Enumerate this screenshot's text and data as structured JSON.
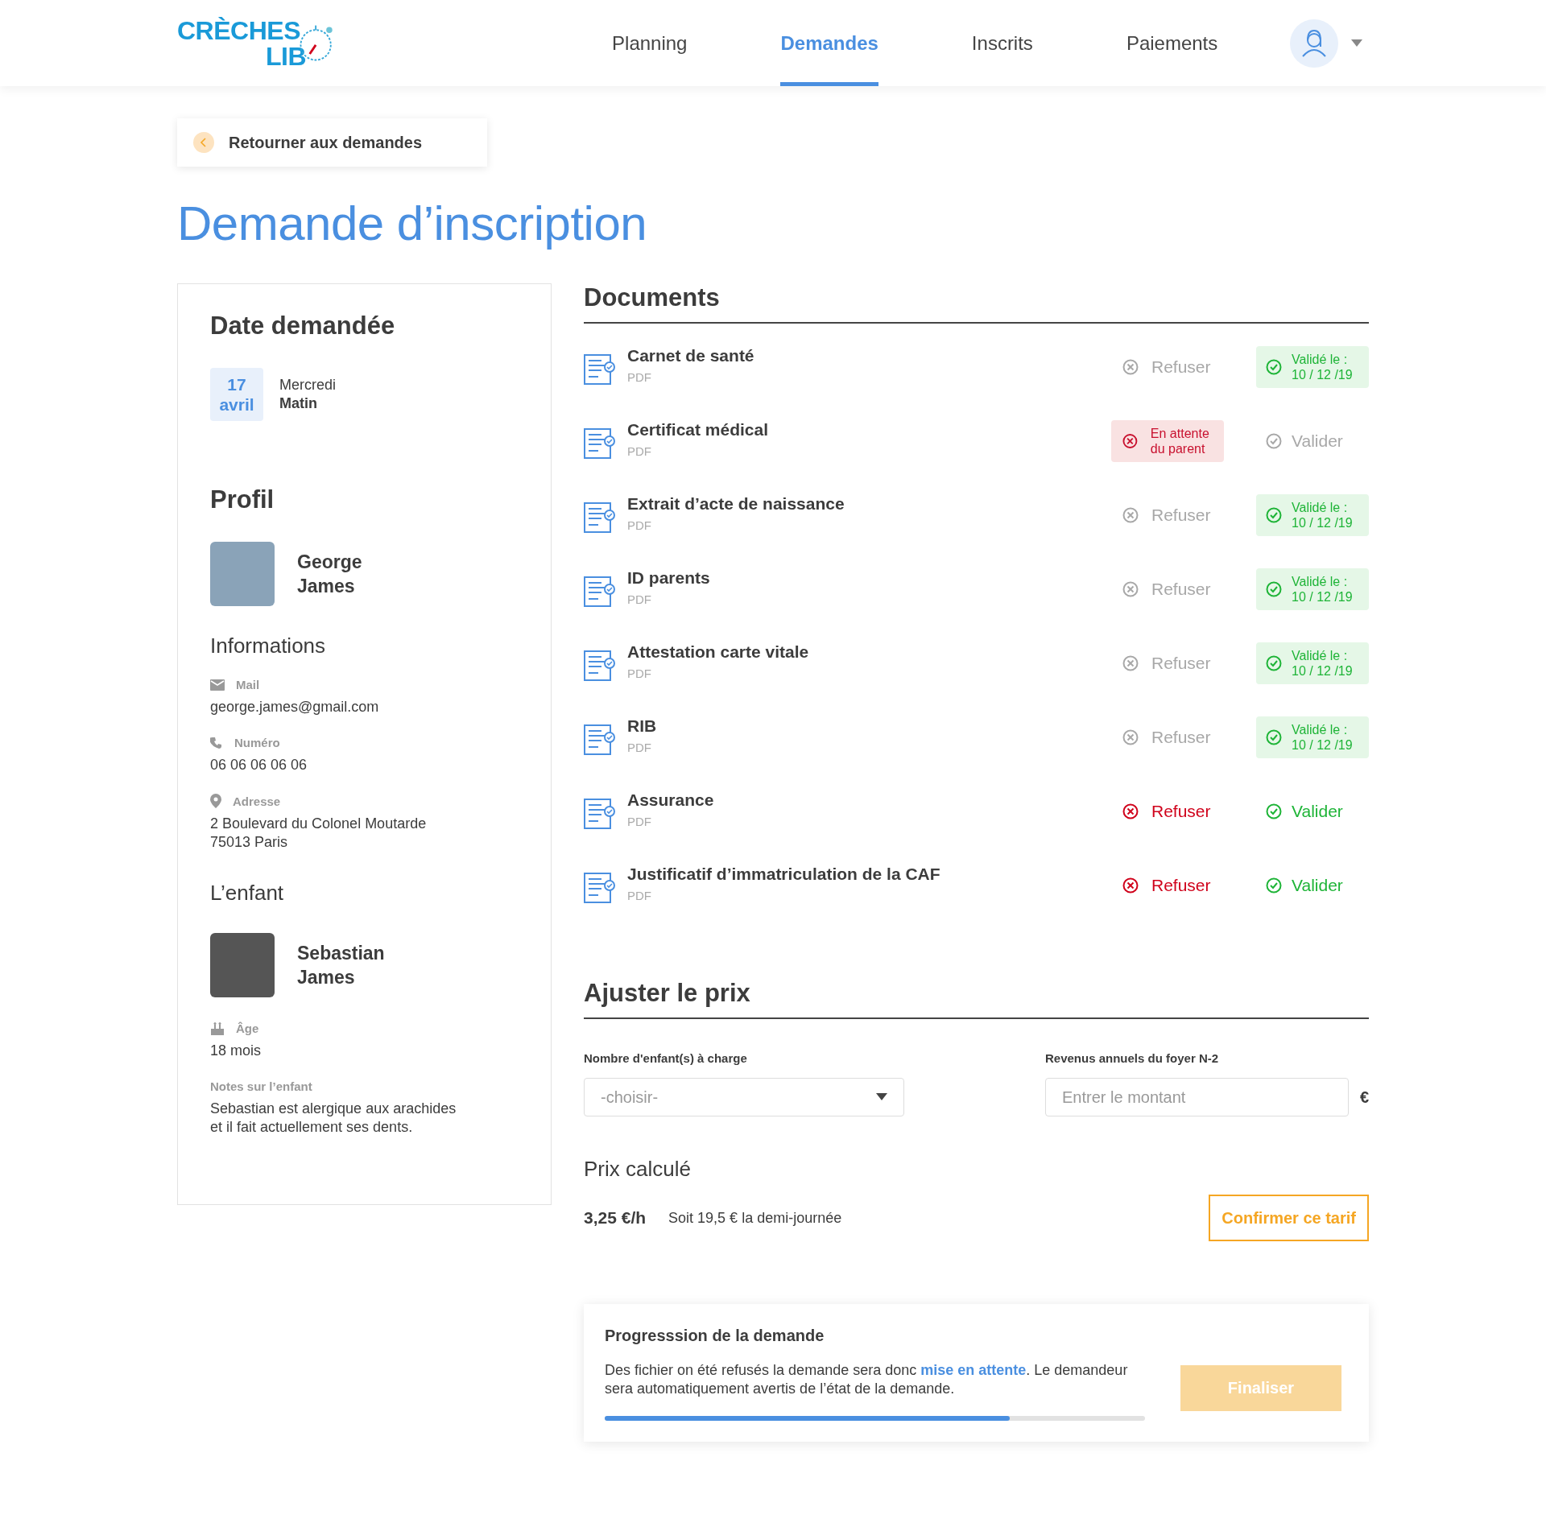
{
  "logo": {
    "line1": "CRÈCHES",
    "line2": "LIB"
  },
  "nav": [
    {
      "label": "Planning",
      "selected": false
    },
    {
      "label": "Demandes",
      "selected": true
    },
    {
      "label": "Inscrits",
      "selected": false
    },
    {
      "label": "Paiements",
      "selected": false
    }
  ],
  "back_button": "Retourner aux demandes",
  "title": "Demande d’inscription",
  "date_section": {
    "heading": "Date demandée",
    "day": "17",
    "month": "avril",
    "weekday": "Mercredi",
    "slot": "Matin"
  },
  "profile": {
    "heading": "Profil",
    "first_name": "George",
    "last_name": "James",
    "info_heading": "Informations",
    "fields": [
      {
        "kind": "mail",
        "label": "Mail",
        "lines": [
          "george.james@gmail.com"
        ]
      },
      {
        "kind": "phone",
        "label": "Numéro",
        "lines": [
          "06 06 06 06 06"
        ]
      },
      {
        "kind": "address",
        "label": "Adresse",
        "lines": [
          "2 Boulevard du Colonel Moutarde",
          "75013 Paris"
        ]
      }
    ]
  },
  "child": {
    "heading": "L’enfant",
    "first_name": "Sebastian",
    "last_name": "James",
    "age_label": "Âge",
    "age": "18 mois",
    "notes_label": "Notes sur l’enfant",
    "notes": "Sebastian est alergique aux arachides et il fait actuellement ses dents."
  },
  "documents": {
    "heading": "Documents",
    "items": [
      {
        "name": "Carnet de santé",
        "type": "PDF",
        "refuse": {
          "kind": "button",
          "label": "Refuser",
          "disabled": true
        },
        "validate": {
          "kind": "badge",
          "label": "Validé le :",
          "date": "10 / 12 /19"
        }
      },
      {
        "name": "Certificat médical",
        "type": "PDF",
        "refuse": {
          "kind": "badge",
          "label": "En attente du parent"
        },
        "validate": {
          "kind": "button",
          "label": "Valider",
          "disabled": true
        }
      },
      {
        "name": "Extrait d’acte de naissance",
        "type": "PDF",
        "refuse": {
          "kind": "button",
          "label": "Refuser",
          "disabled": true
        },
        "validate": {
          "kind": "badge",
          "label": "Validé le :",
          "date": "10 / 12 /19"
        }
      },
      {
        "name": "ID parents",
        "type": "PDF",
        "refuse": {
          "kind": "button",
          "label": "Refuser",
          "disabled": true
        },
        "validate": {
          "kind": "badge",
          "label": "Validé le :",
          "date": "10 / 12 /19"
        }
      },
      {
        "name": "Attestation carte vitale",
        "type": "PDF",
        "refuse": {
          "kind": "button",
          "label": "Refuser",
          "disabled": true
        },
        "validate": {
          "kind": "badge",
          "label": "Validé le :",
          "date": "10 / 12 /19"
        }
      },
      {
        "name": "RIB",
        "type": "PDF",
        "refuse": {
          "kind": "button",
          "label": "Refuser",
          "disabled": true
        },
        "validate": {
          "kind": "badge",
          "label": "Validé le :",
          "date": "10 / 12 /19"
        }
      },
      {
        "name": "Assurance",
        "type": "PDF",
        "refuse": {
          "kind": "button",
          "label": "Refuser",
          "disabled": false
        },
        "validate": {
          "kind": "button",
          "label": "Valider",
          "disabled": false
        }
      },
      {
        "name": "Justificatif d’immatriculation de la CAF",
        "type": "PDF",
        "refuse": {
          "kind": "button",
          "label": "Refuser",
          "disabled": false
        },
        "validate": {
          "kind": "button",
          "label": "Valider",
          "disabled": false
        }
      }
    ]
  },
  "price": {
    "heading": "Ajuster le prix",
    "children_label": "Nombre d'enfant(s) à charge",
    "children_placeholder": "-choisir-",
    "income_label": "Revenus annuels du foyer N-2",
    "income_placeholder": "Entrer le montant",
    "currency": "€",
    "computed_heading": "Prix calculé",
    "rate": "3,25 €/h",
    "half_day": "Soit 19,5 € la demi-journée",
    "confirm_button": "Confirmer ce tarif"
  },
  "progress": {
    "heading": "Progresssion de la demande",
    "message": "Des fichier on été refusés la demande sera donc **mise en attente**. Le demandeur sera automatiquement avertis de l’état de la demande.",
    "level": 0.75,
    "finalize_button": "Finaliser",
    "finalize_disabled": true
  }
}
